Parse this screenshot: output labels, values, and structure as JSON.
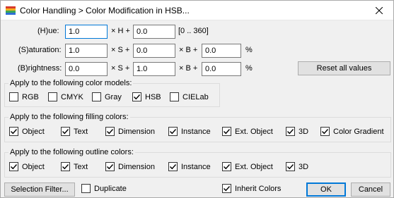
{
  "window": {
    "title": "Color Handling > Color Modification in HSB..."
  },
  "hue": {
    "label": "(H)ue:",
    "v1": "1.0",
    "op1": "× H +",
    "v2": "0.0",
    "range": "[0 .. 360]"
  },
  "saturation": {
    "label": "(S)aturation:",
    "v1": "1.0",
    "op1": "× S +",
    "v2": "0.0",
    "op2": "× B +",
    "v3": "0.0",
    "unit": "%"
  },
  "brightness": {
    "label": "(B)rightness:",
    "v1": "0.0",
    "op1": "× S +",
    "v2": "1.0",
    "op2": "× B +",
    "v3": "0.0",
    "unit": "%"
  },
  "reset_button": "Reset all values",
  "color_models": {
    "title": "Apply to the following color models:",
    "items": [
      {
        "label": "RGB",
        "checked": false
      },
      {
        "label": "CMYK",
        "checked": false
      },
      {
        "label": "Gray",
        "checked": false
      },
      {
        "label": "HSB",
        "checked": true
      },
      {
        "label": "CIELab",
        "checked": false
      }
    ]
  },
  "filling": {
    "title": "Apply to the following filling colors:",
    "items": [
      {
        "label": "Object",
        "checked": true
      },
      {
        "label": "Text",
        "checked": true
      },
      {
        "label": "Dimension",
        "checked": true
      },
      {
        "label": "Instance",
        "checked": true
      },
      {
        "label": "Ext. Object",
        "checked": true
      },
      {
        "label": "3D",
        "checked": true
      },
      {
        "label": "Color Gradient",
        "checked": true
      }
    ]
  },
  "outline": {
    "title": "Apply to the following outline colors:",
    "items": [
      {
        "label": "Object",
        "checked": true
      },
      {
        "label": "Text",
        "checked": true
      },
      {
        "label": "Dimension",
        "checked": true
      },
      {
        "label": "Instance",
        "checked": true
      },
      {
        "label": "Ext. Object",
        "checked": true
      },
      {
        "label": "3D",
        "checked": true
      }
    ]
  },
  "footer": {
    "selection_filter": "Selection Filter...",
    "duplicate": {
      "label": "Duplicate",
      "checked": false
    },
    "inherit_colors": {
      "label": "Inherit Colors",
      "checked": true
    },
    "ok": "OK",
    "cancel": "Cancel"
  }
}
